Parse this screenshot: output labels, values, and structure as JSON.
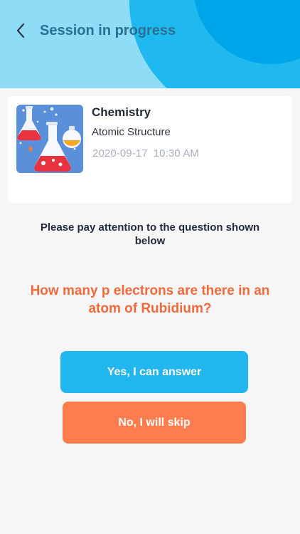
{
  "header": {
    "title": "Session in progress",
    "back_icon": "chevron-left-icon",
    "colors": {
      "background": "#8fdcf7",
      "circle_outer": "#1fb9ef",
      "circle_inner": "#00a6ea",
      "title": "#2b6f93"
    }
  },
  "session_card": {
    "thumbnail_icon": "chemistry-flasks-illustration",
    "subject": "Chemistry",
    "topic": "Atomic Structure",
    "date": "2020-09-17",
    "time": "10:30 AM"
  },
  "prompt": {
    "instruction": "Please pay attention to the question shown below",
    "question": "How many p electrons are there in an atom of Rubidium?"
  },
  "actions": {
    "answer_label": "Yes, I can answer",
    "skip_label": "No, I will skip",
    "answer_color": "#22b6ee",
    "skip_color": "#fd7d4f"
  },
  "colors": {
    "page_background": "#f6f6f7",
    "question_text": "#f26a3c",
    "date_text": "#a9afc0"
  }
}
